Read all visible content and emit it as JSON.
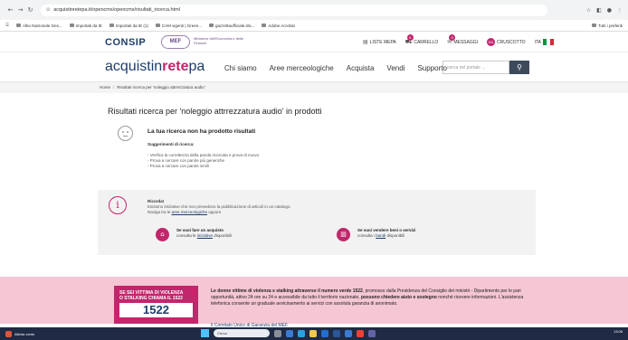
{
  "browser": {
    "url": "acquistinretepa.it/opencms/opencms/risultati_ricerca.html",
    "bookmarks": [
      "Albo Nazionale Ges...",
      "Importati da IE",
      "Importati da IE (1)",
      "CAM vigenti | Green...",
      "gazzettaufficiale.it/a...",
      "Adobe Acrobat"
    ],
    "other_bookmarks": "Tutti i preferiti"
  },
  "consip": {
    "logo": "CONSIP",
    "mef_logo": "MEF",
    "mef_text": "Ministero dell'Economia e delle Finanze",
    "util_nav": {
      "lista_mepa": "LISTE MEPA",
      "carrello": "CARRELLO",
      "carrello_count": "0",
      "messaggi": "MESSAGGI",
      "messaggi_count": "0",
      "cruscotto_badge": "DD",
      "cruscotto": "CRUSCOTTO",
      "lang": "ITA"
    }
  },
  "nav": {
    "logo_a": "acquistin",
    "logo_b": "rete",
    "logo_c": "pa",
    "links": [
      "Chi siamo",
      "Aree merceologiche",
      "Acquista",
      "Vendi",
      "Supporto"
    ],
    "search_placeholder": "cerca nel portale ..."
  },
  "breadcrumb": {
    "home": "Home",
    "current": "Risultati ricerca per 'noleggio attrrezzatura audio'"
  },
  "results": {
    "title": "Risultati ricerca per 'noleggio attrrezzatura audio' in prodotti",
    "no_results": "La tua ricerca non ha prodotto risultati",
    "suggest_title": "Suggerimenti di ricerca:",
    "suggestions": [
      "- Verifica la correttezza della parola ricercata e prova di nuovo",
      "- Prova a cercare con parole più generiche",
      "- Prova a cercare con parole simili"
    ]
  },
  "reminder": {
    "title": "Ricorda!",
    "line1": "Esistono iniziative che non prevedono la pubblicazione di articoli in un catalogo.",
    "line2_pre": "Naviga tra le ",
    "line2_link": "aree merceologiche",
    "line2_post": " oppure",
    "buy_title": "Se vuoi fare un acquisto",
    "buy_pre": "consulta le ",
    "buy_link": "iniziative",
    "buy_post": " disponibili",
    "sell_title": "Se vuoi vendere beni o servizi",
    "sell_pre": "consulta i ",
    "sell_link": "bandi",
    "sell_post": " disponibili"
  },
  "banner": {
    "card_line1": "SE SEI VITTIMA DI VIOLENZA",
    "card_line2": "O STALKING CHIAMA IL 1522",
    "number": "1522",
    "text_bold1": "Le donne vittime di violenza e stalking attraverso il numero verde 1522",
    "text_normal1": ", promosso dalla Presidenza del Consiglio dei ministri - Dipartimento per le pari opportunità, attivo 24 ore su 24 e accessibile da tutto il territorio nazionale, ",
    "text_bold2": "possono chiedere aiuto e sostegno",
    "text_normal2": " nonché ricevere informazioni. L'assistenza telefonica consente un graduale avvicinamento ai servizi con assoluta garanzia di anonimato.",
    "link": "Il Comitato Unico di Garanzia del MEF"
  },
  "taskbar": {
    "weather": "Allerta vento",
    "search": "Cerca",
    "time": "13:06"
  },
  "colors": {
    "brand_blue": "#1c3e6b",
    "brand_magenta": "#c2266c",
    "banner_pink": "#f5c6d3"
  }
}
